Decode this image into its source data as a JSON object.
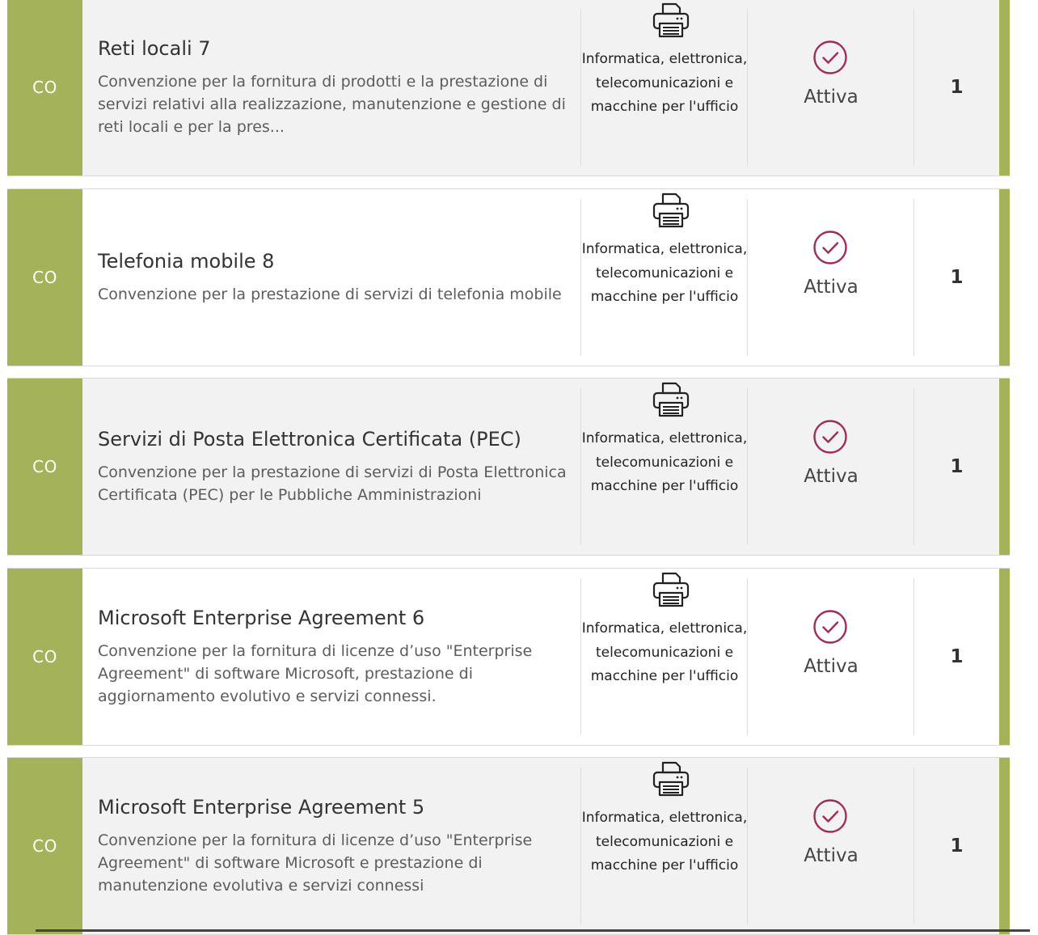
{
  "colors": {
    "badge": "#a4b35a",
    "accent": "#a4b35a",
    "check": "#a02c5a"
  },
  "rows": [
    {
      "badge": "CO",
      "title": "Reti locali 7",
      "description": "Convenzione per la fornitura di prodotti e la prestazione di servizi relativi alla realizzazione, manutenzione e gestione di reti locali e per la pres...",
      "category": "Informatica, elettronica, telecomunicazioni e macchine per l'ufficio",
      "category_icon": "printer-icon",
      "status": "Attiva",
      "status_icon": "check-circle-icon",
      "count": "1"
    },
    {
      "badge": "CO",
      "title": "Telefonia mobile 8",
      "description": "Convenzione per la prestazione di servizi di telefonia mobile",
      "category": "Informatica, elettronica, telecomunicazioni e macchine per l'ufficio",
      "category_icon": "printer-icon",
      "status": "Attiva",
      "status_icon": "check-circle-icon",
      "count": "1"
    },
    {
      "badge": "CO",
      "title": "Servizi di Posta Elettronica Certificata (PEC)",
      "description": "Convenzione per la prestazione di servizi di Posta Elettronica Certificata (PEC) per le Pubbliche Amministrazioni",
      "category": "Informatica, elettronica, telecomunicazioni e macchine per l'ufficio",
      "category_icon": "printer-icon",
      "status": "Attiva",
      "status_icon": "check-circle-icon",
      "count": "1"
    },
    {
      "badge": "CO",
      "title": "Microsoft Enterprise Agreement 6",
      "description": "Convenzione per la fornitura di licenze d’uso \"Enterprise Agreement\" di software Microsoft, prestazione di aggiornamento evolutivo e servizi connessi.",
      "category": "Informatica, elettronica, telecomunicazioni e macchine per l'ufficio",
      "category_icon": "printer-icon",
      "status": "Attiva",
      "status_icon": "check-circle-icon",
      "count": "1"
    },
    {
      "badge": "CO",
      "title": "Microsoft Enterprise Agreement 5",
      "description": "Convenzione per la fornitura di licenze d’uso \"Enterprise Agreement\" di software Microsoft e prestazione di manutenzione evolutiva e servizi connessi",
      "category": "Informatica, elettronica, telecomunicazioni e macchine per l'ufficio",
      "category_icon": "printer-icon",
      "status": "Attiva",
      "status_icon": "check-circle-icon",
      "count": "1"
    }
  ]
}
